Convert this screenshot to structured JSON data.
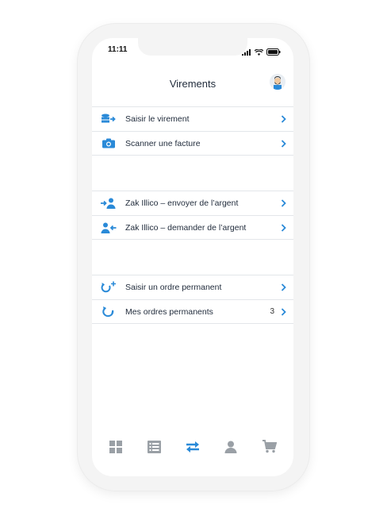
{
  "status": {
    "time": "11:11"
  },
  "header": {
    "title": "Virements"
  },
  "groups": [
    {
      "items": [
        {
          "label": "Saisir le virement",
          "icon": "transfer-database-icon"
        },
        {
          "label": "Scanner une facture",
          "icon": "camera-icon"
        }
      ]
    },
    {
      "items": [
        {
          "label": "Zak Illico – envoyer de l’argent",
          "icon": "person-send-icon"
        },
        {
          "label": "Zak Illico – demander de l’argent",
          "icon": "person-request-icon"
        }
      ]
    },
    {
      "items": [
        {
          "label": "Saisir un ordre permanent",
          "icon": "recurring-add-icon"
        },
        {
          "label": "Mes ordres permanents",
          "icon": "recurring-icon",
          "count": "3"
        }
      ]
    }
  ],
  "tabbar": {
    "tabs": [
      {
        "name": "dashboard",
        "icon": "grid-icon"
      },
      {
        "name": "transactions",
        "icon": "list-icon"
      },
      {
        "name": "transfers",
        "icon": "transfer-arrows-icon",
        "active": true
      },
      {
        "name": "profile",
        "icon": "person-icon"
      },
      {
        "name": "shop",
        "icon": "cart-icon"
      }
    ]
  },
  "colors": {
    "accent": "#2a8ad8",
    "inactive": "#9aa0a6",
    "text": "#1f2a3a",
    "divider": "#e3e6ea"
  }
}
